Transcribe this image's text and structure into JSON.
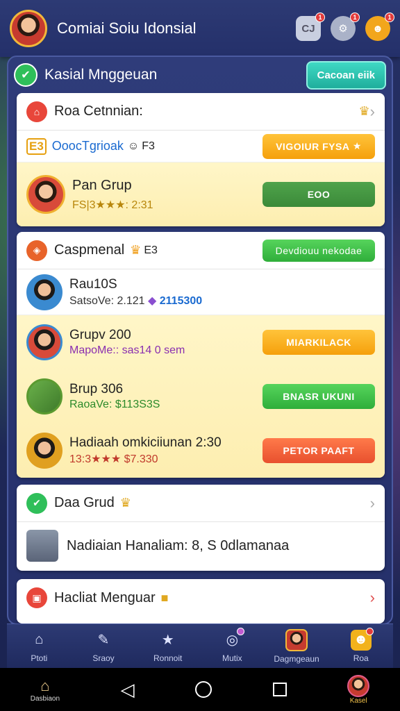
{
  "header": {
    "title": "Comiai Soiu Idonsial",
    "icons": [
      {
        "name": "chat-icon",
        "badge": "1"
      },
      {
        "name": "settings-icon",
        "badge": "1"
      },
      {
        "name": "notification-icon",
        "badge": "1"
      }
    ]
  },
  "panel": {
    "title": "Kasial Mnggeuan",
    "button": "Cacoan eiik"
  },
  "card1": {
    "title": "Roa Cetnnian:",
    "row1": {
      "prefix": "E3",
      "text": "OoocTgrioak",
      "suffix": "F3",
      "button": "VIGOIUR FYSA"
    },
    "row2": {
      "name": "Pan Grup",
      "sub": "FS|3★★★: 2:31",
      "button": "EOO"
    }
  },
  "card2": {
    "title": "Caspmenal",
    "title_suffix": "E3",
    "button": "Devdiouu nekodae",
    "rows": [
      {
        "name": "Rau10S",
        "sub": "SatsoVe: 2.121",
        "sub2": "2115300",
        "button": ""
      },
      {
        "name": "Grupv 200",
        "sub": "MapoMe:: sas14 0 sem",
        "sub2": "",
        "button": "MIARKILACK"
      },
      {
        "name": "Brup 306",
        "sub": "RaoaVe: $113S3S",
        "sub2": "",
        "button": "BNASR UKUNI"
      },
      {
        "name": "Hadiaah omkiciiunan 2:30",
        "sub": "13:3★★★ $7.330",
        "sub2": "",
        "button": "PETOR PAAFT"
      }
    ]
  },
  "card3": {
    "title": "Daa Grud",
    "row": "Nadiaian Hanaliam: 8, S 0dlamanaa"
  },
  "card4": {
    "title": "Hacliat Menguar"
  },
  "bottomnav": [
    "Ptoti",
    "Sraoy",
    "Ronnoit",
    "Mutix",
    "Dagmgeaun",
    "Roa"
  ],
  "sysnav": {
    "home_label": "Dasbiaon",
    "profile_label": "Kasel"
  },
  "colors": {
    "accent": "#2d3a74",
    "orange": "#f5a00c",
    "green": "#2fae3a",
    "red": "#e8502e",
    "teal": "#1fae9c"
  }
}
